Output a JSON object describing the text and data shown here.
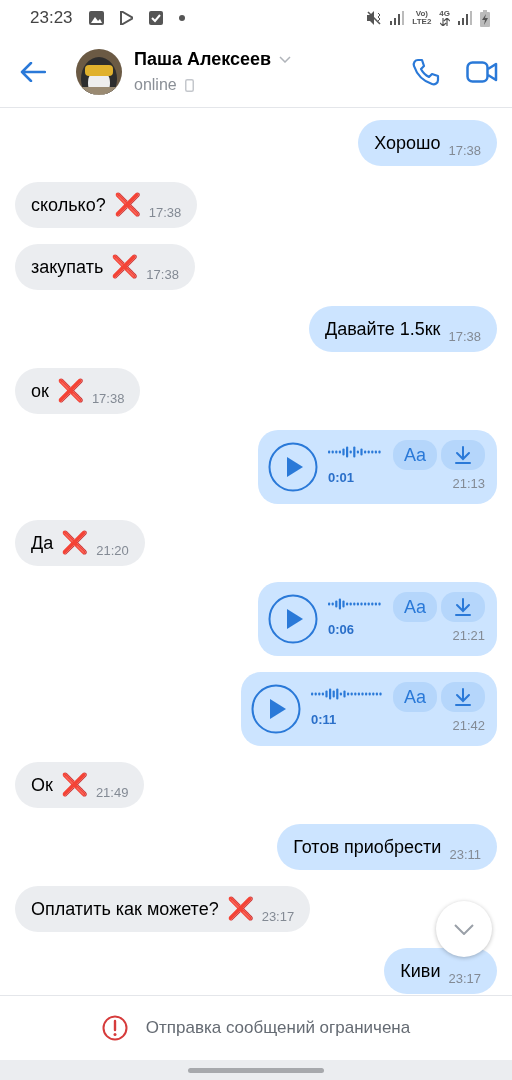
{
  "status_bar": {
    "time": "23:23",
    "volte": "Vo)",
    "lte": "LTE2",
    "network": "4G"
  },
  "header": {
    "name": "Паша Алексеев",
    "status": "online"
  },
  "messages": [
    {
      "kind": "text",
      "outgoing": true,
      "text": "Хорошо",
      "time": "17:38"
    },
    {
      "kind": "text",
      "outgoing": false,
      "text": "сколько?",
      "emoji": "❌",
      "time": "17:38"
    },
    {
      "kind": "text",
      "outgoing": false,
      "text": "закупать",
      "emoji": "❌",
      "time": "17:38"
    },
    {
      "kind": "text",
      "outgoing": true,
      "text": "Давайте 1.5кк",
      "time": "17:38"
    },
    {
      "kind": "text",
      "outgoing": false,
      "text": "ок",
      "emoji": "❌",
      "time": "17:38"
    },
    {
      "kind": "voice",
      "outgoing": true,
      "duration": "0:01",
      "transcribe": "Aa",
      "time": "21:13"
    },
    {
      "kind": "text",
      "outgoing": false,
      "text": "Да",
      "emoji": "❌",
      "time": "21:20"
    },
    {
      "kind": "voice",
      "outgoing": true,
      "duration": "0:06",
      "transcribe": "Aa",
      "time": "21:21"
    },
    {
      "kind": "voice",
      "outgoing": true,
      "duration": "0:11",
      "transcribe": "Aa",
      "time": "21:42"
    },
    {
      "kind": "text",
      "outgoing": false,
      "text": "Ок",
      "emoji": "❌",
      "time": "21:49"
    },
    {
      "kind": "text",
      "outgoing": true,
      "text": "Готов приобрести",
      "time": "23:11"
    },
    {
      "kind": "text",
      "outgoing": false,
      "text": "Оплатить как можете?",
      "emoji": "❌",
      "time": "23:17"
    },
    {
      "kind": "text",
      "outgoing": true,
      "text": "Киви",
      "time": "23:17"
    }
  ],
  "restriction": {
    "text": "Отправка сообщений ограничена"
  }
}
